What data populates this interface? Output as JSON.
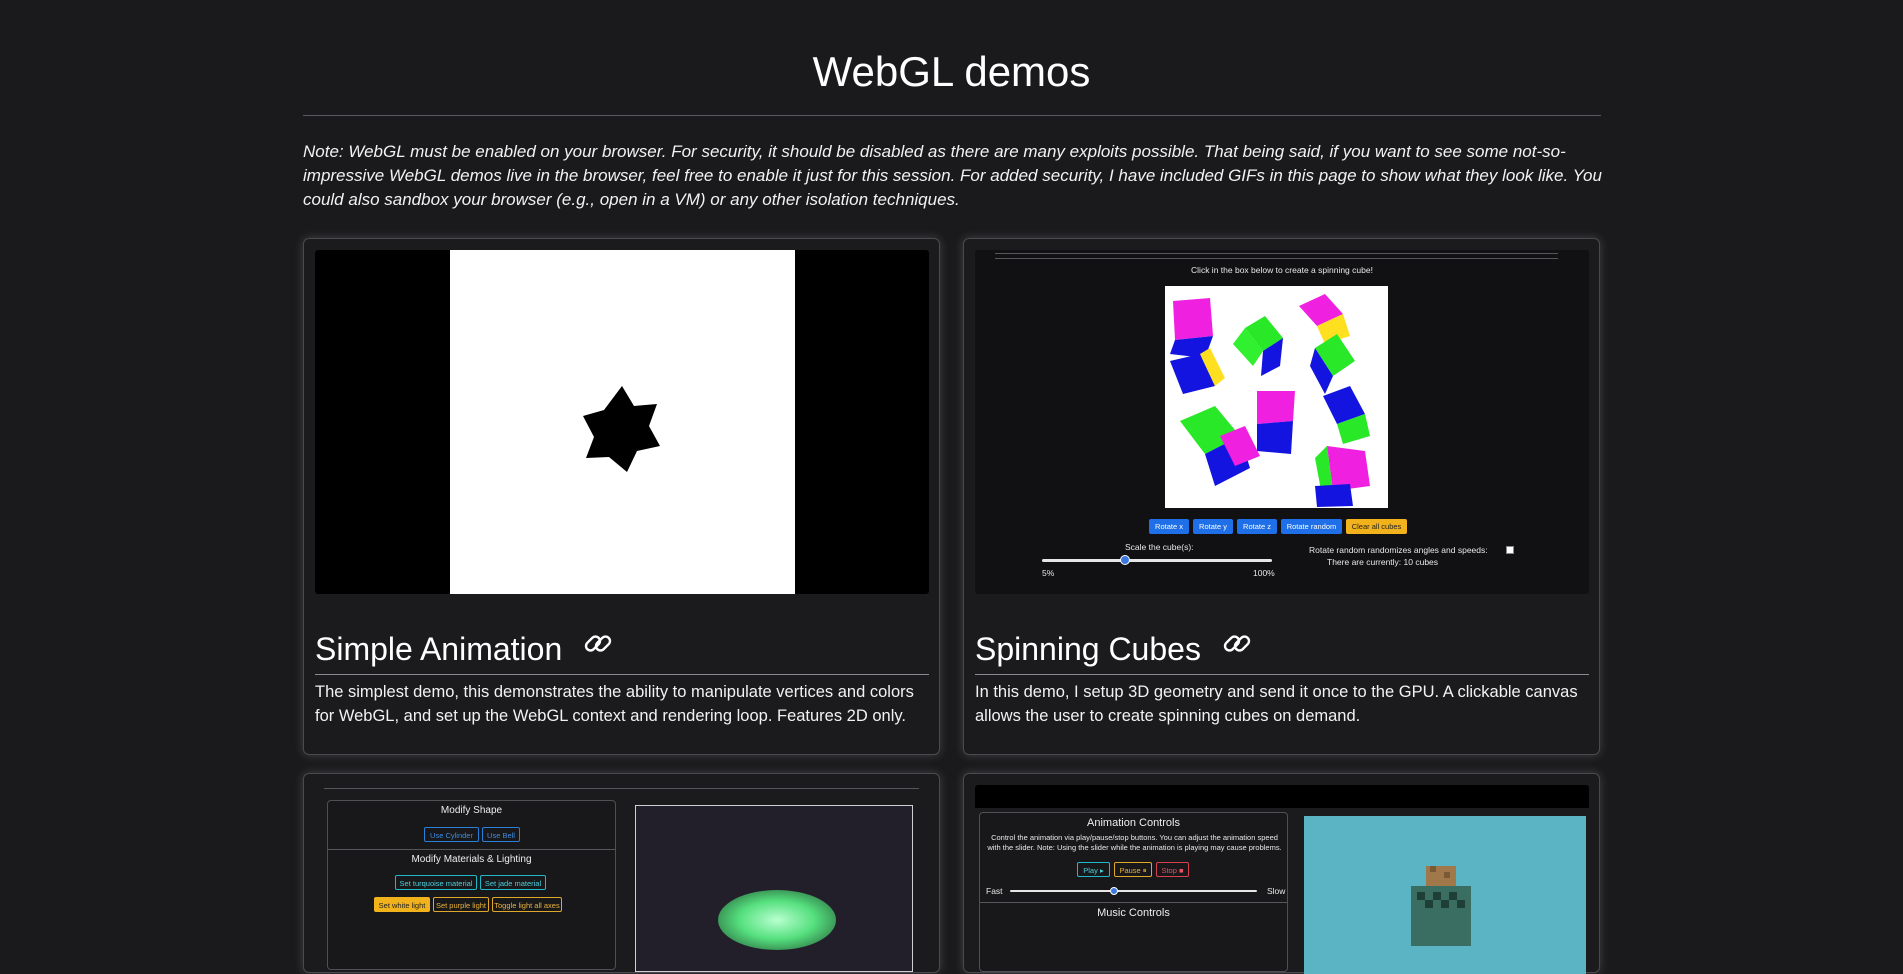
{
  "page": {
    "title": "WebGL demos",
    "note": "Note: WebGL must be enabled on your browser. For security, it should be disabled as there are many exploits possible. That being said, if you want to see some not-so-impressive WebGL demos live in the browser, feel free to enable it just for this session. For added security, I have included GIFs in this page to show what they look like. You could also sandbox your browser (e.g., open in a VM) or any other isolation techniques."
  },
  "cards": [
    {
      "title": "Simple Animation",
      "link_icon": "link-icon",
      "description": "The simplest demo, this demonstrates the ability to manipulate vertices and colors for WebGL, and set up the WebGL context and rendering loop. Features 2D only."
    },
    {
      "title": "Spinning Cubes",
      "link_icon": "link-icon",
      "description": "In this demo, I setup 3D geometry and send it once to the GPU. A clickable canvas allows the user to create spinning cubes on demand.",
      "preview": {
        "instruction": "Click in the box below to create a spinning cube!",
        "buttons": [
          "Rotate x",
          "Rotate y",
          "Rotate z",
          "Rotate random",
          "Clear all cubes"
        ],
        "slider_label": "Scale the cube(s):",
        "slider_min": "5%",
        "slider_max": "100%",
        "slider_value": 0.35,
        "random_note": "Rotate random randomizes angles and speeds:",
        "cube_count": "There are currently: 10 cubes"
      }
    },
    {
      "preview": {
        "modify_shape": "Modify Shape",
        "shape_buttons": [
          "Use Cylinder",
          "Use Bell"
        ],
        "materials_heading": "Modify Materials & Lighting",
        "material_buttons": [
          "Set turquoise material",
          "Set jade material"
        ],
        "light_buttons": [
          "Set white light",
          "Set purple light",
          "Toggle light all axes"
        ]
      }
    },
    {
      "preview": {
        "animation_heading": "Animation Controls",
        "animation_text": "Control the animation via play/pause/stop buttons. You can adjust the animation speed with the slider. Note: Using the slider while the animation is playing may cause problems.",
        "buttons": [
          "Play ▸",
          "Pause ⏸",
          "Stop ■"
        ],
        "speed_fast": "Fast",
        "speed_slow": "Slow",
        "speed_value": 0.42,
        "music_heading": "Music Controls"
      }
    }
  ],
  "colors": {
    "background": "#1a1a1c",
    "primary_button": "#1f6fe8",
    "warning_button": "#f2b21b",
    "canvas_teal": "#5ab4c4"
  }
}
